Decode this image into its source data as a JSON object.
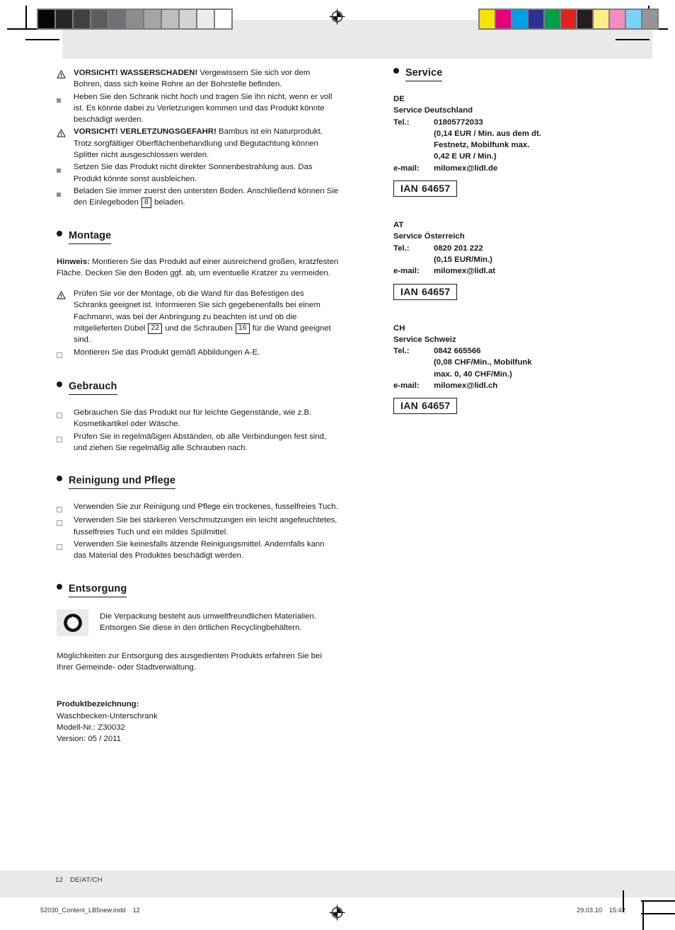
{
  "print_marks": {
    "gray_swatches": [
      "#050505",
      "#262626",
      "#414141",
      "#5d5d5d",
      "#6f7174",
      "#8b8d8f",
      "#a2a4a5",
      "#bdbfbe",
      "#d2d4d2",
      "#ececea",
      "#ffffff"
    ],
    "color_swatches": [
      "#f6e500",
      "#e5007d",
      "#00a0e2",
      "#2e3192",
      "#00a04a",
      "#e3211d",
      "#231f20",
      "#faee83",
      "#f48cc0",
      "#77d2f5",
      "#939598"
    ],
    "registration_icon": "registration-target-icon"
  },
  "left_column": {
    "safety_list": [
      {
        "bullet": "warning-triangle-icon",
        "bold": "VORSICHT! WASSERSCHADEN!",
        "text": " Vergewissern Sie sich vor dem Bohren, dass sich keine Rohre an der Bohrstelle befinden."
      },
      {
        "bullet": "filled-square-bullet",
        "bold": "",
        "text": "Heben Sie den Schrank nicht hoch und tragen Sie ihn nicht, wenn er voll ist. Es könnte dabei zu Verletzungen kommen und das Produkt könnte beschädigt werden."
      },
      {
        "bullet": "warning-triangle-icon",
        "bold": "VORSICHT! VERLETZUNGSGEFAHR!",
        "text": " Bambus ist ein Naturprodukt. Trotz sorgfältiger Oberflächenbehandlung und Begutachtung können Splitter nicht ausgeschlossen werden."
      },
      {
        "bullet": "filled-square-bullet",
        "bold": "",
        "text": "Setzen Sie das Produkt nicht direkter Sonnenbestrahlung aus. Das Produkt könnte sonst ausbleichen."
      },
      {
        "bullet": "filled-square-bullet",
        "bold": "",
        "text": "Beladen Sie immer zuerst den untersten Boden. Anschließend können Sie den Einlegeboden ",
        "ref": "8",
        "text_after": " beladen."
      }
    ],
    "montage": {
      "heading": "Montage",
      "note_label": "Hinweis:",
      "note_text": " Montieren Sie das Produkt auf einer ausreichend großen, kratzfesten Fläche. Decken Sie den Boden ggf. ab, um eventuelle Kratzer zu vermeiden.",
      "items": [
        {
          "bullet": "warning-triangle-icon",
          "text": "Prüfen Sie vor der Montage, ob die Wand für das Befestigen des Schranks geeignet ist. Informieren Sie sich gegebenenfalls bei einem Fachmann, was bei der Anbringung zu beachten ist und ob die mitgelieferten Dübel ",
          "ref": "22",
          "text_mid": " und die Schrauben ",
          "ref2": "16",
          "text_after": " für die Wand geeignet sind."
        },
        {
          "bullet": "hollow-square-bullet",
          "text": "Montieren Sie das Produkt gemäß Abbildungen A-E."
        }
      ]
    },
    "gebrauch": {
      "heading": "Gebrauch",
      "items": [
        "Gebrauchen Sie das Produkt nur für leichte Gegenstände, wie z.B. Kosmetikartikel oder Wäsche.",
        "Prüfen Sie in regelmäßigen Abständen, ob alle Verbindungen fest sind, und ziehen Sie regelmäßig alle Schrauben nach."
      ]
    },
    "reinigung": {
      "heading": "Reinigung und Pflege",
      "items": [
        "Verwenden Sie zur Reinigung und Pflege ein trockenes, fusselfreies Tuch.",
        "Verwenden Sie bei stärkeren Verschmutzungen ein leicht angefeuchtetes, fusselfreies Tuch und ein mildes Spülmittel.",
        "Verwenden Sie keinesfalls ätzende Reinigungsmittel. Andernfalls kann das Material des Produktes beschädigt werden."
      ]
    },
    "entsorgung": {
      "heading": "Entsorgung",
      "badge_icon": "green-dot-recycling-icon",
      "badge_text": "Die Verpackung besteht aus umweltfreundlichen Materialien. Entsorgen Sie diese in den örtlichen Recyclingbehältern.",
      "paragraph": "Möglichkeiten zur Entsorgung des ausgedienten Produkts erfahren Sie bei Ihrer Gemeinde- oder Stadtverwaltung.",
      "product_label": "Produktbezeichnung:",
      "product_name": "Waschbecken-Unterschrank",
      "model": "Modell-Nr.: Z30032",
      "version": "Version: 05 / 2011"
    }
  },
  "right_column": {
    "heading": "Service",
    "blocks": [
      {
        "country_code": "DE",
        "service_name": "Service Deutschland",
        "tel_label": "Tel.:",
        "tel_value": "01805772033",
        "tel_notes": [
          "(0,14 EUR / Min. aus dem dt.",
          "Festnetz, Mobilfunk max.",
          "0,42 E UR / Min.)"
        ],
        "email_label": "e-mail:",
        "email_value": "milomex@lidl.de",
        "ian_label": "IAN",
        "ian_number": "64657"
      },
      {
        "country_code": "AT",
        "service_name": "Service Österreich",
        "tel_label": "Tel.:",
        "tel_value": "0820 201 222",
        "tel_notes": [
          "(0,15 EUR/Min.)"
        ],
        "email_label": "e-mail:",
        "email_value": "milomex@lidl.at",
        "ian_label": "IAN",
        "ian_number": "64657"
      },
      {
        "country_code": "CH",
        "service_name": "Service Schweiz",
        "tel_label": "Tel.:",
        "tel_value": "0842 665566",
        "tel_notes": [
          "(0,08 CHF/Min., Mobilfunk",
          "max. 0, 40 CHF/Min.)"
        ],
        "email_label": "e-mail:",
        "email_value": "milomex@lidl.ch",
        "ian_label": "IAN",
        "ian_number": "64657"
      }
    ]
  },
  "footer": {
    "page_number": "12",
    "page_locale": "DE/AT/CH",
    "file_name": "52030_Content_LB5new.indd",
    "file_page": "12",
    "date": "29.03.10",
    "time": "15:42"
  }
}
